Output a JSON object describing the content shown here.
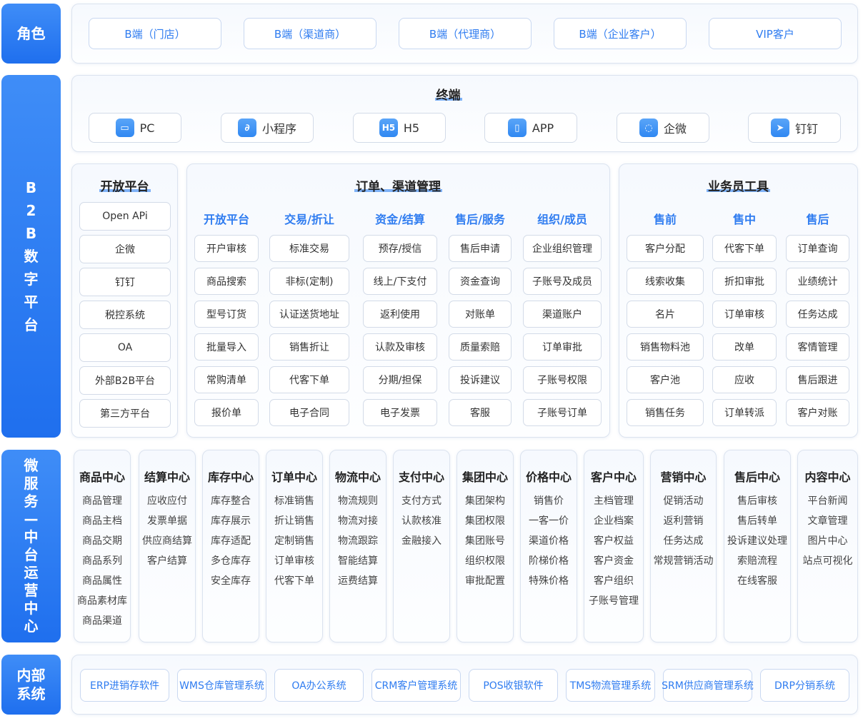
{
  "labels": {
    "role": "角色",
    "platform": [
      "B",
      "2",
      "B",
      "数",
      "字",
      "平",
      "台"
    ],
    "middle": [
      "微",
      "服",
      "务",
      "—",
      "中",
      "台",
      "运",
      "营",
      "中",
      "心"
    ],
    "internal": "内部\n系统"
  },
  "roles": [
    "B端（门店）",
    "B端（渠道商）",
    "B端（代理商）",
    "B端（企业客户）",
    "VIP客户"
  ],
  "terminals": {
    "title": "终端",
    "items": [
      {
        "label": "PC",
        "icon": "monitor-icon",
        "glyph": "▭"
      },
      {
        "label": "小程序",
        "icon": "mini-program-icon",
        "glyph": "∂"
      },
      {
        "label": "H5",
        "icon": "h5-icon",
        "glyph": "H5"
      },
      {
        "label": "APP",
        "icon": "phone-icon",
        "glyph": "▯"
      },
      {
        "label": "企微",
        "icon": "wecom-icon",
        "glyph": "◌"
      },
      {
        "label": "钉钉",
        "icon": "dingtalk-icon",
        "glyph": "➤"
      }
    ]
  },
  "open_platform": {
    "title": "开放平台",
    "items": [
      "Open APi",
      "企微",
      "钉钉",
      "税控系统",
      "OA",
      "外部B2B平台",
      "第三方平台"
    ]
  },
  "order_channel": {
    "title": "订单、渠道管理",
    "columns": [
      {
        "head": "开放平台",
        "items": [
          "开户审核",
          "商品搜索",
          "型号订货",
          "批量导入",
          "常购清单",
          "报价单"
        ]
      },
      {
        "head": "交易/折让",
        "items": [
          "标准交易",
          "非标(定制)",
          "认证送货地址",
          "销售折让",
          "代客下单",
          "电子合同"
        ]
      },
      {
        "head": "资金/结算",
        "items": [
          "预存/授信",
          "线上/下支付",
          "返利使用",
          "认款及审核",
          "分期/担保",
          "电子发票"
        ]
      },
      {
        "head": "售后/服务",
        "items": [
          "售后申请",
          "资金查询",
          "对账单",
          "质量索赔",
          "投诉建议",
          "客服"
        ]
      },
      {
        "head": "组织/成员",
        "items": [
          "企业组织管理",
          "子账号及成员",
          "渠道账户",
          "订单审批",
          "子账号权限",
          "子账号订单"
        ]
      }
    ]
  },
  "sales_tools": {
    "title": "业务员工具",
    "columns": [
      {
        "head": "售前",
        "items": [
          "客户分配",
          "线索收集",
          "名片",
          "销售物料池",
          "客户池",
          "销售任务"
        ]
      },
      {
        "head": "售中",
        "items": [
          "代客下单",
          "折扣审批",
          "订单审核",
          "改单",
          "应收",
          "订单转派"
        ]
      },
      {
        "head": "售后",
        "items": [
          "订单查询",
          "业绩统计",
          "任务达成",
          "客情管理",
          "售后跟进",
          "客户对账"
        ]
      }
    ]
  },
  "middle_platform": [
    {
      "title": "商品中心",
      "items": [
        "商品管理",
        "商品主档",
        "商品交期",
        "商品系列",
        "商品属性",
        "商品素材库",
        "商品渠道"
      ]
    },
    {
      "title": "结算中心",
      "items": [
        "应收应付",
        "发票单据",
        "供应商结算",
        "客户结算"
      ]
    },
    {
      "title": "库存中心",
      "items": [
        "库存整合",
        "库存展示",
        "库存适配",
        "多仓库存",
        "安全库存"
      ]
    },
    {
      "title": "订单中心",
      "items": [
        "标准销售",
        "折让销售",
        "定制销售",
        "订单审核",
        "代客下单"
      ]
    },
    {
      "title": "物流中心",
      "items": [
        "物流规则",
        "物流对接",
        "物流跟踪",
        "智能结算",
        "运费结算"
      ]
    },
    {
      "title": "支付中心",
      "items": [
        "支付方式",
        "认款核准",
        "金融接入"
      ]
    },
    {
      "title": "集团中心",
      "items": [
        "集团架构",
        "集团权限",
        "集团账号",
        "组织权限",
        "审批配置"
      ]
    },
    {
      "title": "价格中心",
      "items": [
        "销售价",
        "一客一价",
        "渠道价格",
        "阶梯价格",
        "特殊价格"
      ]
    },
    {
      "title": "客户中心",
      "items": [
        "主档管理",
        "企业档案",
        "客户权益",
        "客户资金",
        "客户组织",
        "子账号管理"
      ]
    },
    {
      "title": "营销中心",
      "items": [
        "促销活动",
        "返利营销",
        "任务达成",
        "常规营销活动"
      ]
    },
    {
      "title": "售后中心",
      "items": [
        "售后审核",
        "售后转单",
        "投诉建议处理",
        "索赔流程",
        "在线客服"
      ]
    },
    {
      "title": "内容中心",
      "items": [
        "平台新闻",
        "文章管理",
        "图片中心",
        "站点可视化"
      ]
    }
  ],
  "internal_systems": [
    "ERP进销存软件",
    "WMS仓库管理系统",
    "OA办公系统",
    "CRM客户管理系统",
    "POS收银软件",
    "TMS物流管理系统",
    "SRM供应商管理系统",
    "DRP分销系统"
  ]
}
